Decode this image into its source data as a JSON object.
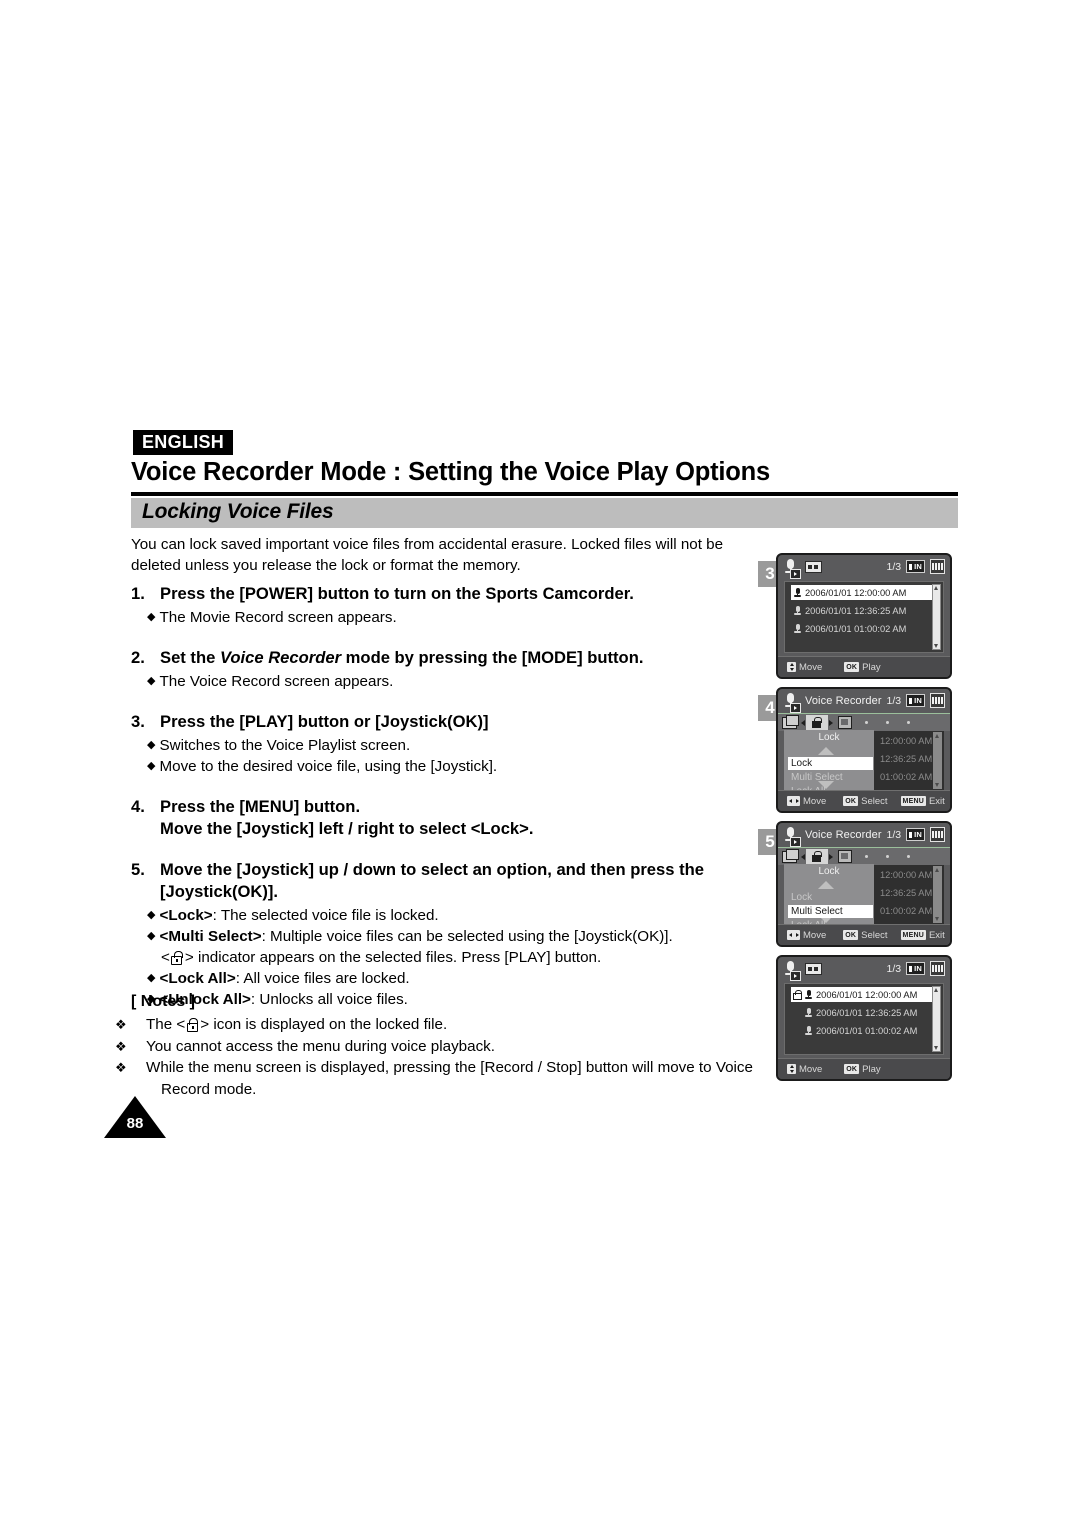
{
  "header": {
    "language_badge": "ENGLISH",
    "title": "Voice Recorder Mode : Setting the Voice Play Options",
    "section_title": "Locking Voice Files"
  },
  "intro": "You can lock saved important voice files from accidental erasure. Locked files will not be deleted unless you release the lock or format the memory.",
  "steps": [
    {
      "num": "1.",
      "head": "Press the [POWER] button to turn on the Sports Camcorder.",
      "bullets": [
        "The Movie Record screen appears."
      ]
    },
    {
      "num": "2.",
      "head_pre": "Set the ",
      "head_italic": "Voice Recorder",
      "head_post": " mode by pressing the [MODE] button.",
      "bullets": [
        "The Voice Record screen appears."
      ]
    },
    {
      "num": "3.",
      "head": "Press the [PLAY] button or [Joystick(OK)]",
      "bullets": [
        "Switches to the Voice Playlist screen.",
        "Move to the desired voice file, using the [Joystick]."
      ]
    },
    {
      "num": "4.",
      "head": "Press the [MENU] button.",
      "head_line2": "Move the [Joystick] left / right to select <Lock>.",
      "bullets": []
    },
    {
      "num": "5.",
      "head": "Move the [Joystick] up / down to select an option, and then press the",
      "head_line2": "[Joystick(OK)].",
      "bullets": [
        {
          "term": "<Lock>",
          "rest": ": The selected voice file is locked."
        },
        {
          "term": "<Multi Select>",
          "rest": ": Multiple voice files can be selected using the [Joystick(OK)]."
        },
        {
          "term": "<Lock All>",
          "rest": ": All voice files are locked."
        },
        {
          "term": "<Unlock All>",
          "rest": ": Unlocks all voice files."
        }
      ],
      "multi_select_note_pre": "<",
      "multi_select_note_post": "> indicator appears on the selected files. Press [PLAY] button."
    }
  ],
  "notes": {
    "title": "[ Notes ]",
    "items": [
      {
        "pre": "The <",
        "post": "> icon is displayed on the locked file.",
        "has_lock_icon": true
      },
      {
        "text": "You cannot access the menu during voice playback.",
        "has_lock_icon": false
      },
      {
        "text": "While the menu screen is displayed, pressing the [Record / Stop] button will move to Voice Record mode.",
        "has_lock_icon": false
      }
    ]
  },
  "page_number": "88",
  "lcd_panels": [
    {
      "badge": "3",
      "type": "playlist",
      "title": "",
      "counter": "1/3",
      "memory": "IN",
      "files": [
        {
          "name": "2006/01/01 12:00:00 AM",
          "selected": true,
          "locked": false
        },
        {
          "name": "2006/01/01 12:36:25 AM",
          "selected": false,
          "locked": false
        },
        {
          "name": "2006/01/01 01:00:02 AM",
          "selected": false,
          "locked": false
        }
      ],
      "hints": [
        {
          "key": "UD",
          "label": "Move"
        },
        {
          "key": "OK",
          "label": "Play"
        }
      ]
    },
    {
      "badge": "4",
      "type": "menu",
      "title": "Voice Recorder",
      "counter": "1/3",
      "memory": "IN",
      "tab_label": "Lock",
      "menu_items": [
        {
          "label": "Lock",
          "selected": true
        },
        {
          "label": "Multi Select",
          "selected": false
        },
        {
          "label": "Lock All",
          "selected": false
        }
      ],
      "bg_files": [
        {
          "name": "12:00:00 AM"
        },
        {
          "name": "12:36:25 AM"
        },
        {
          "name": "01:00:02 AM"
        }
      ],
      "hints": [
        {
          "key": "LRUD",
          "label": "Move"
        },
        {
          "key": "OK",
          "label": "Select"
        },
        {
          "key": "MENU",
          "label": "Exit"
        }
      ]
    },
    {
      "badge": "5",
      "type": "menu",
      "title": "Voice Recorder",
      "counter": "1/3",
      "memory": "IN",
      "tab_label": "Lock",
      "menu_items": [
        {
          "label": "Lock",
          "selected": false
        },
        {
          "label": "Multi Select",
          "selected": true
        },
        {
          "label": "Lock All",
          "selected": false
        }
      ],
      "bg_files": [
        {
          "name": "12:00:00 AM"
        },
        {
          "name": "12:36:25 AM"
        },
        {
          "name": "01:00:02 AM"
        }
      ],
      "hints": [
        {
          "key": "LRUD",
          "label": "Move"
        },
        {
          "key": "OK",
          "label": "Select"
        },
        {
          "key": "MENU",
          "label": "Exit"
        }
      ]
    },
    {
      "badge": "",
      "type": "playlist",
      "title": "",
      "counter": "1/3",
      "memory": "IN",
      "files": [
        {
          "name": "2006/01/01 12:00:00 AM",
          "selected": true,
          "locked": true
        },
        {
          "name": "2006/01/01 12:36:25 AM",
          "selected": false,
          "locked": false
        },
        {
          "name": "2006/01/01 01:00:02 AM",
          "selected": false,
          "locked": false
        }
      ],
      "hints": [
        {
          "key": "UD",
          "label": "Move"
        },
        {
          "key": "OK",
          "label": "Play"
        }
      ]
    }
  ],
  "colors": {
    "band": "#bdbdbd",
    "lcd_body": "#5a5a5c",
    "lcd_list": "#3a3a3a",
    "badge": "#9a9a9a"
  }
}
